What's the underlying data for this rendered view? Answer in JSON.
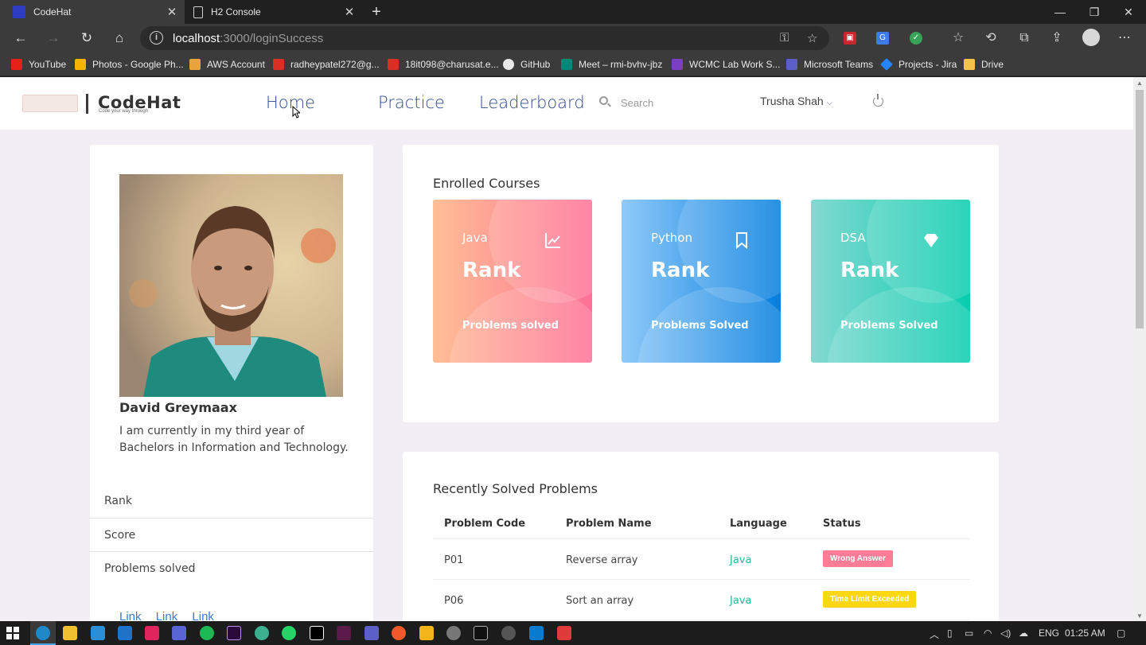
{
  "browser": {
    "tabs": [
      {
        "title": "CodeHat",
        "active": true
      },
      {
        "title": "H2 Console",
        "active": false
      }
    ],
    "url_host": "localhost",
    "url_path": ":3000/loginSuccess",
    "bookmarks": [
      {
        "label": "YouTube",
        "color": "#e62117"
      },
      {
        "label": "Photos - Google Ph...",
        "color": "#f4b400"
      },
      {
        "label": "AWS Account",
        "color": "#e8a33c"
      },
      {
        "label": "radheypatel272@g...",
        "color": "#d93025"
      },
      {
        "label": "18it098@charusat.e...",
        "color": "#d93025"
      },
      {
        "label": "GitHub",
        "color": "#e8e8e8"
      },
      {
        "label": "Meet – rmi-bvhv-jbz",
        "color": "#00897b"
      },
      {
        "label": "WCMC Lab Work S...",
        "color": "#7b3fc4"
      },
      {
        "label": "Microsoft Teams",
        "color": "#5b5fc7"
      },
      {
        "label": "Projects - Jira",
        "color": "#2684ff"
      },
      {
        "label": "Drive",
        "color": "#f5c24c"
      }
    ]
  },
  "site": {
    "logo_text": "CodeHat",
    "logo_tagline": "Code your way through",
    "nav": {
      "home": "Home",
      "practice": "Practice",
      "leaderboard": "Leaderboard"
    },
    "search_placeholder": "Search",
    "user_name": "Trusha Shah"
  },
  "profile": {
    "name": "David Greymaax",
    "bio": "I am currently in my third year of Bachelors in Information and Technology.",
    "stats": [
      "Rank",
      "Score",
      "Problems solved"
    ],
    "links": [
      "Link",
      "Link",
      "Link"
    ]
  },
  "courses": {
    "title": "Enrolled Courses",
    "items": [
      {
        "name": "Java",
        "rank_label": "Rank",
        "solved_label": "Problems solved",
        "icon": "chart-line-icon",
        "gradient": [
          "#ffbf96",
          "#fe7096"
        ]
      },
      {
        "name": "Python",
        "rank_label": "Rank",
        "solved_label": "Problems Solved",
        "icon": "bookmark-icon",
        "gradient": [
          "#90caf9",
          "#047edf"
        ]
      },
      {
        "name": "DSA",
        "rank_label": "Rank",
        "solved_label": "Problems Solved",
        "icon": "diamond-icon",
        "gradient": [
          "#84d9d2",
          "#07cdae"
        ]
      }
    ]
  },
  "recent": {
    "title": "Recently Solved Problems",
    "headers": [
      "Problem Code",
      "Problem Name",
      "Language",
      "Status"
    ],
    "rows": [
      {
        "code": "P01",
        "name": "Reverse array",
        "language": "Java",
        "status": "Wrong Answer",
        "status_color": "#fe7c96"
      },
      {
        "code": "P06",
        "name": "Sort an array",
        "language": "Java",
        "status": "Time Limit Exceeded",
        "status_color": "#fed713"
      }
    ]
  },
  "taskbar": {
    "lang": "ENG",
    "time": "01:25 AM"
  }
}
